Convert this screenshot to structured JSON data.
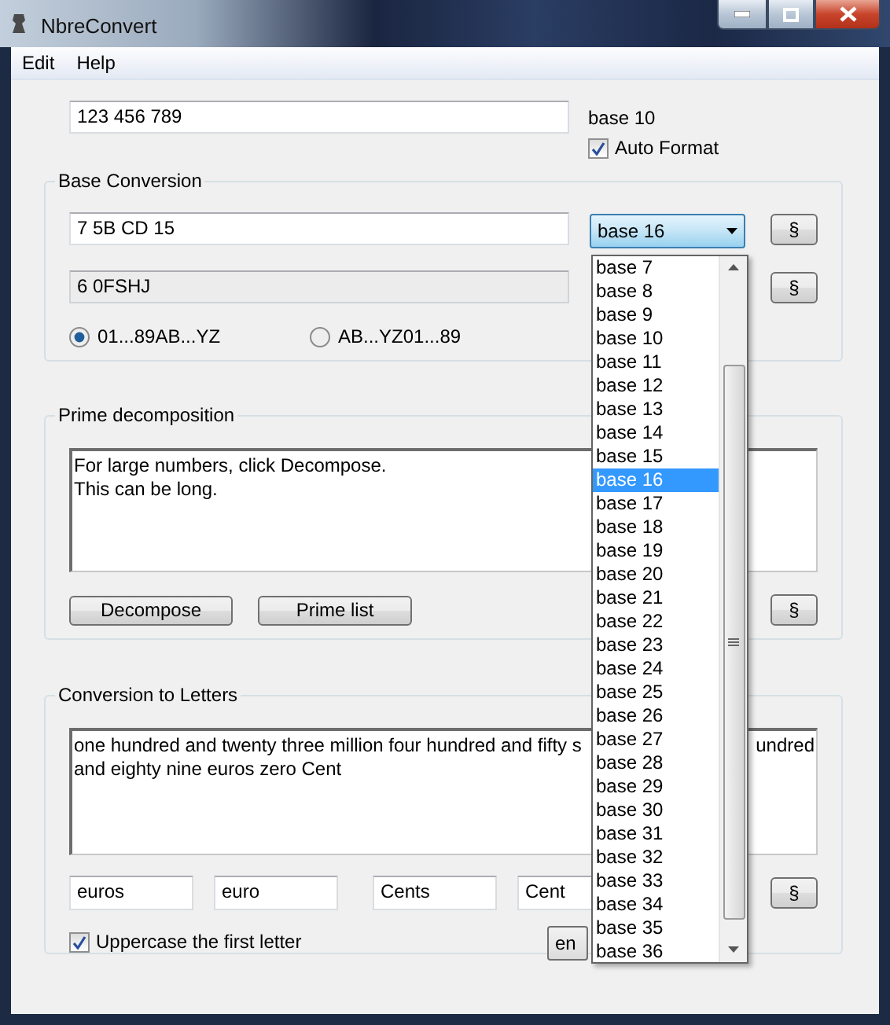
{
  "window": {
    "title": "NbreConvert"
  },
  "menu": [
    "Edit",
    "Help"
  ],
  "number": {
    "value": "123 456 789",
    "base_label": "base 10",
    "auto_format": {
      "label": "Auto Format",
      "checked": true
    }
  },
  "base_conversion": {
    "title": "Base Conversion",
    "result": "7 5B CD 15",
    "result2": "6 0FSHJ",
    "buttons": [
      "§",
      "§"
    ],
    "base_select": {
      "value": "base 16",
      "expanded": true,
      "options": [
        {
          "label": "base 7",
          "selected": false
        },
        {
          "label": "base 8",
          "selected": false
        },
        {
          "label": "base 9",
          "selected": false
        },
        {
          "label": "base 10",
          "selected": false
        },
        {
          "label": "base 11",
          "selected": false
        },
        {
          "label": "base 12",
          "selected": false
        },
        {
          "label": "base 13",
          "selected": false
        },
        {
          "label": "base 14",
          "selected": false
        },
        {
          "label": "base 15",
          "selected": false
        },
        {
          "label": "base 16",
          "selected": true
        },
        {
          "label": "base 17",
          "selected": false
        },
        {
          "label": "base 18",
          "selected": false
        },
        {
          "label": "base 19",
          "selected": false
        },
        {
          "label": "base 20",
          "selected": false
        },
        {
          "label": "base 21",
          "selected": false
        },
        {
          "label": "base 22",
          "selected": false
        },
        {
          "label": "base 23",
          "selected": false
        },
        {
          "label": "base 24",
          "selected": false
        },
        {
          "label": "base 25",
          "selected": false
        },
        {
          "label": "base 26",
          "selected": false
        },
        {
          "label": "base 27",
          "selected": false
        },
        {
          "label": "base 28",
          "selected": false
        },
        {
          "label": "base 29",
          "selected": false
        },
        {
          "label": "base 30",
          "selected": false
        },
        {
          "label": "base 31",
          "selected": false
        },
        {
          "label": "base 32",
          "selected": false
        },
        {
          "label": "base 33",
          "selected": false
        },
        {
          "label": "base 34",
          "selected": false
        },
        {
          "label": "base 35",
          "selected": false
        },
        {
          "label": "base 36",
          "selected": false
        }
      ]
    },
    "orders": [
      {
        "label": "01...89AB...YZ",
        "selected": true
      },
      {
        "label": "AB...YZ01...89",
        "selected": false
      }
    ]
  },
  "prime": {
    "title": "Prime decomposition",
    "text_lines": [
      "For large numbers, click Decompose.",
      "This can be long."
    ],
    "buttons": [
      "Decompose",
      "Prime list"
    ],
    "para_button": "§"
  },
  "letters": {
    "title": "Conversion to Letters",
    "text_lines": [
      {
        "left": "one hundred and twenty three million four hundred and fifty s",
        "right": "undred"
      },
      {
        "left": "and eighty nine euros zero Cent"
      }
    ],
    "units": [
      "euros",
      "euro",
      "Cents",
      "Cent"
    ],
    "para_button": "§",
    "uppercase": {
      "label": "Uppercase the first letter",
      "checked": true
    },
    "language": "en"
  }
}
